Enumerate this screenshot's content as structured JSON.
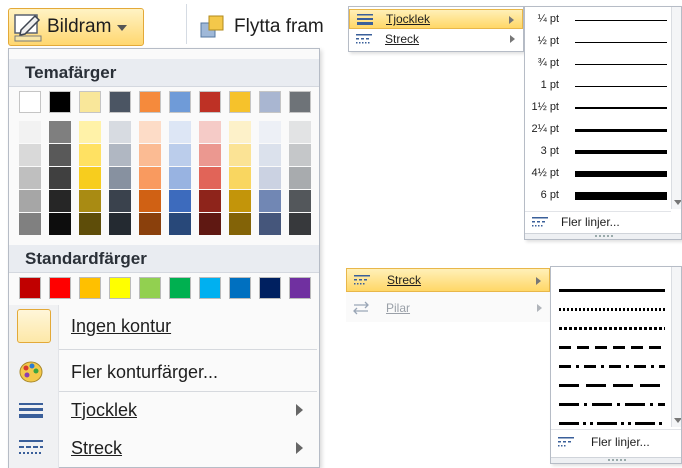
{
  "ribbon": {
    "bildram_label": "Bildram",
    "flytta_label": "Flytta fram"
  },
  "outline_menu": {
    "theme_colors_heading": "Temafärger",
    "standard_colors_heading": "Standardfärger",
    "theme_top_row": [
      "#ffffff",
      "#000000",
      "#f9e79a",
      "#4b5563",
      "#f58a3c",
      "#6f9bd8",
      "#be3125",
      "#f6c22b",
      "#a9b6d1",
      "#6e7378"
    ],
    "theme_shades": [
      [
        "#f2f2f2",
        "#d9d9d9",
        "#bfbfbf",
        "#a6a6a6",
        "#808080"
      ],
      [
        "#7f7f7f",
        "#595959",
        "#404040",
        "#262626",
        "#0d0d0d"
      ],
      [
        "#fff2a8",
        "#ffe162",
        "#f7cd1e",
        "#a98b13",
        "#5e4d09"
      ],
      [
        "#d7dbe1",
        "#b0b7c2",
        "#8791a0",
        "#3a424d",
        "#242a31"
      ],
      [
        "#fddcc7",
        "#fbbb93",
        "#f99a5f",
        "#d06114",
        "#8a400c"
      ],
      [
        "#dde6f5",
        "#bbcdeb",
        "#98b3e1",
        "#3d6bbd",
        "#284879"
      ],
      [
        "#f5cbc7",
        "#eb9890",
        "#e16458",
        "#8e241b",
        "#5f1812"
      ],
      [
        "#fdf1c9",
        "#fbe395",
        "#f9d660",
        "#c3950a",
        "#836307"
      ],
      [
        "#edf0f6",
        "#dbe1ec",
        "#cbd2e2",
        "#7187b4",
        "#45567b"
      ],
      [
        "#e2e3e4",
        "#c5c7c9",
        "#a8abae",
        "#53575b",
        "#37393c"
      ]
    ],
    "standard_colors": [
      "#c00000",
      "#ff0000",
      "#ffc000",
      "#ffff00",
      "#92d050",
      "#00b050",
      "#00b0f0",
      "#0070c0",
      "#002060",
      "#7030a0"
    ],
    "no_outline_label": "Ingen kontur",
    "more_colors_label": "Fler konturfärger...",
    "weight_label": "Tjocklek",
    "dashes_label": "Streck"
  },
  "weight_submenu": {
    "parent_items": [
      {
        "label": "Tjocklek",
        "icon": "weight-icon"
      },
      {
        "label": "Streck",
        "icon": "dashes-icon"
      }
    ],
    "weights": [
      {
        "label": "¼ pt",
        "pt": 0.25
      },
      {
        "label": "½ pt",
        "pt": 0.5
      },
      {
        "label": "¾ pt",
        "pt": 0.75
      },
      {
        "label": "1 pt",
        "pt": 1
      },
      {
        "label": "1½ pt",
        "pt": 1.5
      },
      {
        "label": "2¼ pt",
        "pt": 2.25
      },
      {
        "label": "3 pt",
        "pt": 3
      },
      {
        "label": "4½ pt",
        "pt": 4.5
      },
      {
        "label": "6 pt",
        "pt": 6
      }
    ],
    "more_lines_label": "Fler linjer..."
  },
  "dash_submenu": {
    "parent_items": [
      {
        "label": "Streck",
        "icon": "dashes-icon"
      },
      {
        "label": "Pilar",
        "icon": "arrows-icon"
      }
    ],
    "dash_styles": [
      "solid",
      "round-dot",
      "square-dot",
      "dash",
      "dash-dot",
      "long-dash",
      "long-dash-dot",
      "long-dash-dot-dot"
    ],
    "more_lines_label": "Fler linjer..."
  }
}
